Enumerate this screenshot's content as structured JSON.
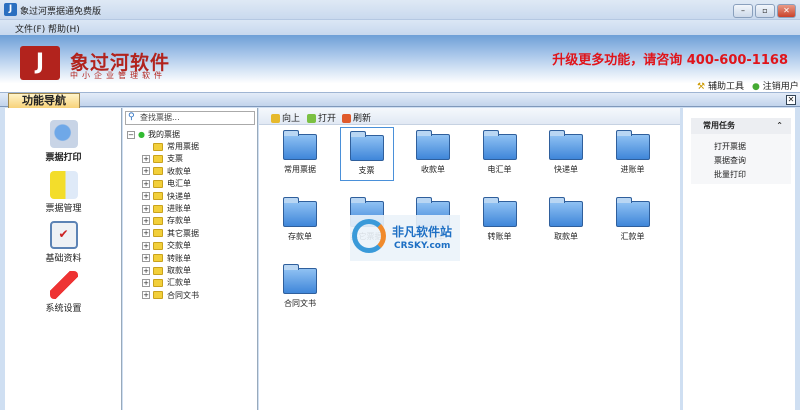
{
  "window": {
    "title": "象过河票据通免费版",
    "minimize": "–",
    "maximize": "▫",
    "close": "✕"
  },
  "menu": [
    "文件(F)",
    "帮助(H)"
  ],
  "banner": {
    "brand": "象过河软件",
    "slogan": "中小企业管理软件",
    "upgrade": "升级更多功能，请咨询 400-600-1168",
    "tools": [
      "辅助工具",
      "注销用户"
    ]
  },
  "tab": {
    "label": "功能导航",
    "close": "✕"
  },
  "nav": [
    {
      "label": "票据打印",
      "icon": "printer-icon"
    },
    {
      "label": "票据管理",
      "icon": "clipboard-icon"
    },
    {
      "label": "基础资料",
      "icon": "checklist-icon"
    },
    {
      "label": "系统设置",
      "icon": "wrench-icon"
    }
  ],
  "tree": {
    "search_placeholder": "查找票据...",
    "root": "我的票据",
    "items": [
      "常用票据",
      "支票",
      "收款单",
      "电汇单",
      "快递单",
      "进账单",
      "存款单",
      "其它票据",
      "交款单",
      "转账单",
      "取款单",
      "汇款单",
      "合同文书"
    ]
  },
  "toolbar": [
    "向上",
    "打开",
    "刷新"
  ],
  "grid": [
    "常用票据",
    "支票",
    "收款单",
    "电汇单",
    "快递单",
    "进账单",
    "存款单",
    "其它票据",
    "交款单",
    "转账单",
    "取款单",
    "汇款单",
    "合同文书"
  ],
  "selected": "支票",
  "watermark": {
    "cn": "非凡软件站",
    "en": "CRSKY.com"
  },
  "tasks": {
    "title": "常用任务",
    "collapse": "⌃",
    "items": [
      "打开票据",
      "票据查询",
      "批量打印"
    ]
  }
}
